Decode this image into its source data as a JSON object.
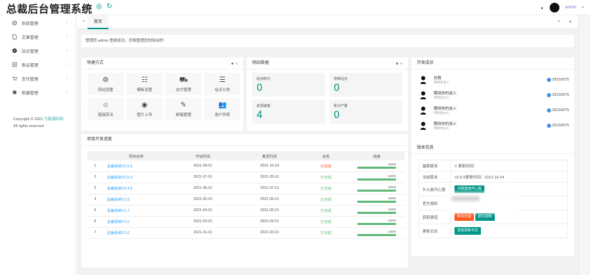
{
  "app": {
    "title": "总裁后台管理系统",
    "admin_name": "admin"
  },
  "header": {
    "menu_icon": "menu-icon",
    "web_icon": "globe-icon",
    "refresh_icon": "refresh-icon",
    "theme_icon": "palette-icon"
  },
  "sidebar": {
    "items": [
      {
        "label": "系统管理",
        "icon": "gear-icon"
      },
      {
        "label": "文章管理",
        "icon": "document-icon"
      },
      {
        "label": "站点管理",
        "icon": "compass-icon"
      },
      {
        "label": "表云管理",
        "icon": "cloud-doc-icon"
      },
      {
        "label": "支付管理",
        "icon": "cart-icon"
      },
      {
        "label": "拓展管理",
        "icon": "puzzle-icon"
      }
    ],
    "copyright_prefix": "Copyright © 2021",
    "copyright_link": "万能源码网",
    "rights": "All rights reserved"
  },
  "tabs": {
    "home": "首页",
    "back_icon": "double-left-icon",
    "next_icon": "double-right-icon",
    "more_icon": "chevron-down-icon"
  },
  "welcome": "管理员 admin 登录成功，尽情管理您的网站吧!",
  "quick": {
    "title": "快捷方式",
    "items": [
      {
        "label": "网站设置",
        "icon": "gear-icon",
        "glyph": "⚙"
      },
      {
        "label": "模板设置",
        "icon": "sliders-icon",
        "glyph": "☷"
      },
      {
        "label": "支付管理",
        "icon": "cart-icon",
        "glyph": "⛟"
      },
      {
        "label": "站点分类",
        "icon": "layers-icon",
        "glyph": "☰"
      },
      {
        "label": "链接库法",
        "icon": "smile-icon",
        "glyph": "☺"
      },
      {
        "label": "图片上传",
        "icon": "compass-icon",
        "glyph": "◉"
      },
      {
        "label": "邮箱管理",
        "icon": "note-icon",
        "glyph": "✎"
      },
      {
        "label": "用户列表",
        "icon": "users-icon",
        "glyph": "👥"
      }
    ]
  },
  "stats": {
    "title": "网站数据",
    "items": [
      {
        "label": "站点统计",
        "value": "0"
      },
      {
        "label": "待审站点",
        "value": "0"
      },
      {
        "label": "友情链接",
        "value": "4"
      },
      {
        "label": "累计产量",
        "value": "0"
      }
    ]
  },
  "devs": {
    "title": "开发成员",
    "items": [
      {
        "name": "总裁",
        "role": "项目负责人",
        "qq": "28150975"
      },
      {
        "name": "期待你的加入",
        "role": "项目合伙人",
        "qq": "28150975"
      },
      {
        "name": "期待你的加入",
        "role": "项目合伙人",
        "qq": "28150975"
      },
      {
        "name": "期待你的加入",
        "role": "项目合伙人",
        "qq": "28150975"
      }
    ]
  },
  "progress": {
    "title": "项目开发进度",
    "headers": [
      "",
      "项目名称",
      "开始时间",
      "截至时间",
      "状态",
      "进度"
    ],
    "rows": [
      {
        "no": "1",
        "name": "总裁系统V2.5.5",
        "start": "2021-09-01",
        "end": "2021-10-24",
        "status": "已完成",
        "red": true,
        "pct": "100%",
        "fill": 1.0
      },
      {
        "no": "2",
        "name": "总裁系统V2.5.0",
        "start": "2021-07-01",
        "end": "2021-05-01",
        "status": "已完成",
        "red": false,
        "pct": "100%",
        "fill": 1.0
      },
      {
        "no": "3",
        "name": "总裁系统V2.4.5",
        "start": "2021-06-01",
        "end": "2021-07-01",
        "status": "已完成",
        "red": false,
        "pct": "100%",
        "fill": 1.0
      },
      {
        "no": "4",
        "name": "总裁系统V1.9",
        "start": "2021-05-01",
        "end": "2021-06-01",
        "status": "已完成",
        "red": false,
        "pct": "100%",
        "fill": 1.0
      },
      {
        "no": "5",
        "name": "总裁系统V1.7",
        "start": "2021-04-01",
        "end": "2021-05-01",
        "status": "已完成",
        "red": false,
        "pct": "100%",
        "fill": 1.0
      },
      {
        "no": "6",
        "name": "总裁系统V1.5",
        "start": "2021-03-01",
        "end": "2021-04-01",
        "status": "已完成",
        "red": false,
        "pct": "100%",
        "fill": 1.0
      },
      {
        "no": "7",
        "name": "总裁系统V1.0",
        "start": "2021-01-01",
        "end": "2021-03-01",
        "status": "已完成",
        "red": false,
        "pct": "100%",
        "fill": 1.0
      }
    ]
  },
  "version": {
    "title": "版本信息",
    "latest_label": "最新版本",
    "latest_value": "V 更新时间：",
    "current_label": "当前版本",
    "current_value": "V2.5.5更新时间：2021-10-24",
    "why_label": "什么是开心版",
    "why_button": "点我直接开心版",
    "official_label": "官方授权",
    "get_label": "获取渠道",
    "get_button1": "购买正版",
    "get_button2": "前往官网",
    "log_label": "更新日志",
    "log_button": "查看更新日志"
  },
  "colors": {
    "accent": "#009688",
    "link": "#1e9fff",
    "success": "#5fb878",
    "danger": "#ff5722"
  }
}
